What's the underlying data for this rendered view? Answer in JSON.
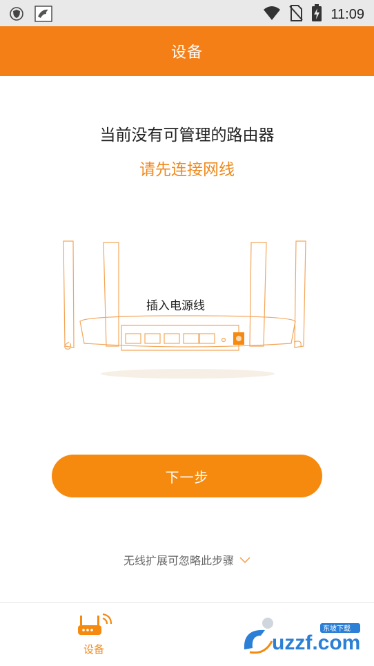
{
  "status_bar": {
    "time": "11:09",
    "icons": [
      "shield-icon",
      "bird-app-icon",
      "wifi-icon",
      "no-sim-icon",
      "battery-charging-icon"
    ]
  },
  "app_bar": {
    "title": "设备"
  },
  "main": {
    "headline": "当前没有可管理的路由器",
    "subline": "请先连接网线",
    "router_caption": "插入电源线",
    "next_button_label": "下一步",
    "skip_text": "无线扩展可忽略此步骤"
  },
  "bottom_nav": {
    "items": [
      {
        "label": "设备",
        "icon": "router-icon",
        "active": true
      }
    ]
  },
  "watermark": {
    "text": "uzzf.com",
    "tagline": "东坡下载"
  },
  "colors": {
    "accent": "#f57f17",
    "accent_text": "#f08a1c",
    "button": "#f58a0f"
  }
}
